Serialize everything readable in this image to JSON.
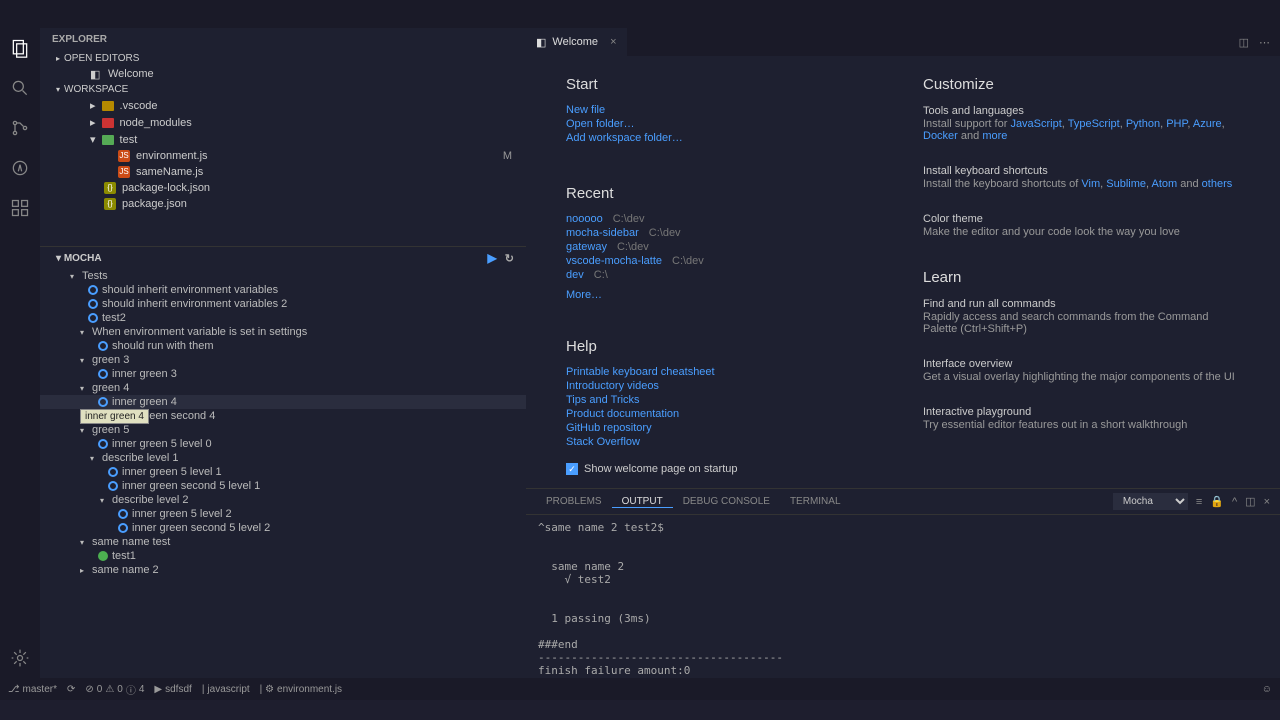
{
  "explorer": {
    "title": "EXPLORER",
    "openEditors": "OPEN EDITORS",
    "workspace": "WORKSPACE",
    "welcomeItem": "Welcome",
    "files": {
      "vscode": ".vscode",
      "node_modules": "node_modules",
      "test": "test",
      "environment": "environment.js",
      "sameName": "sameName.js",
      "packageLock": "package-lock.json",
      "package": "package.json"
    },
    "statusM": "M"
  },
  "mocha": {
    "title": "MOCHA",
    "tree": {
      "tests": "Tests",
      "t1": "should inherit environment variables",
      "t2": "should inherit environment variables 2",
      "t3": "test2",
      "group_when": "When environment variable is set in settings",
      "t4": "should run with them",
      "green3": "green 3",
      "inner_green3": "inner green 3",
      "green4": "green 4",
      "inner_green4": "inner green 4",
      "inner_green_second4": "inner green second 4",
      "green5": "green 5",
      "inner_green5_l0": "inner green 5 level 0",
      "describe1": "describe level 1",
      "inner_green5_l1": "inner green 5 level 1",
      "inner_green_second5_l1": "inner green second 5 level 1",
      "describe2": "describe level 2",
      "inner_green5_l2": "inner green 5 level 2",
      "inner_green_second5_l2": "inner green second 5 level 2",
      "same_name_test": "same name test",
      "test1": "test1",
      "same_name_2": "same name 2"
    },
    "tooltip": "inner green 4"
  },
  "tab": {
    "welcome": "Welcome"
  },
  "welcome": {
    "start": "Start",
    "start_links": {
      "newfile": "New file",
      "openfolder": "Open folder…",
      "addws": "Add workspace folder…"
    },
    "recent": "Recent",
    "recents": [
      {
        "name": "nooooo",
        "path": "C:\\dev"
      },
      {
        "name": "mocha-sidebar",
        "path": "C:\\dev"
      },
      {
        "name": "gateway",
        "path": "C:\\dev"
      },
      {
        "name": "vscode-mocha-latte",
        "path": "C:\\dev"
      },
      {
        "name": "dev",
        "path": "C:\\"
      }
    ],
    "more": "More…",
    "help": "Help",
    "help_links": {
      "cheatsheet": "Printable keyboard cheatsheet",
      "videos": "Introductory videos",
      "tips": "Tips and Tricks",
      "docs": "Product documentation",
      "github": "GitHub repository",
      "stack": "Stack Overflow"
    },
    "show_welcome": "Show welcome page on startup",
    "customize": "Customize",
    "tools_lang": "Tools and languages",
    "tools_desc_pre": "Install support for ",
    "links_lang": {
      "js": "JavaScript",
      "ts": "TypeScript",
      "py": "Python",
      "php": "PHP",
      "az": "Azure",
      "dk": "Docker"
    },
    "and": " and ",
    "more_link": "more",
    "keyboard": "Install keyboard shortcuts",
    "keyboard_desc_pre": "Install the keyboard shortcuts of ",
    "links_kb": {
      "vim": "Vim",
      "subl": "Sublime",
      "atom": "Atom"
    },
    "others": "others",
    "theme": "Color theme",
    "theme_desc": "Make the editor and your code look the way you love",
    "learn": "Learn",
    "commands": "Find and run all commands",
    "commands_desc": "Rapidly access and search commands from the Command Palette (Ctrl+Shift+P)",
    "overview": "Interface overview",
    "overview_desc": "Get a visual overlay highlighting the major components of the UI",
    "playground": "Interactive playground",
    "playground_desc": "Try essential editor features out in a short walkthrough"
  },
  "panel": {
    "problems": "PROBLEMS",
    "output": "OUTPUT",
    "debug": "DEBUG CONSOLE",
    "terminal": "TERMINAL",
    "channel": "Mocha",
    "text": "^same name 2 test2$\n\n\n  same name 2\n    √ test2\n\n\n  1 passing (3ms)\n\n###end\n-------------------------------------\nfinish failure amount:0"
  },
  "statusbar": {
    "branch": "master*",
    "sync": "⟳",
    "errors": "0",
    "warnings": "0",
    "info": "4",
    "run": "sdfsdf",
    "lang": "javascript",
    "file": "environment.js"
  }
}
